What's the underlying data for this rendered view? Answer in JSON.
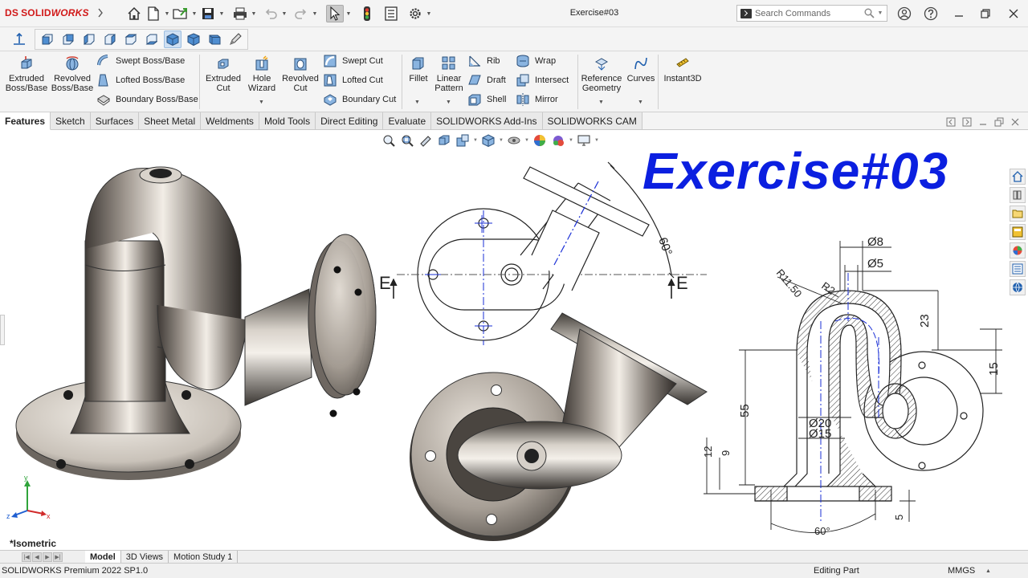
{
  "app": {
    "logo_prefix": "DS",
    "logo_solid": "SOLID",
    "logo_works": "WORKS",
    "document_title": "Exercise#03"
  },
  "search": {
    "placeholder": "Search Commands"
  },
  "ribbon": {
    "extruded_boss": "Extruded Boss/Base",
    "revolved_boss": "Revolved Boss/Base",
    "swept_boss": "Swept Boss/Base",
    "lofted_boss": "Lofted Boss/Base",
    "boundary_boss": "Boundary Boss/Base",
    "extruded_cut": "Extruded Cut",
    "hole_wizard": "Hole Wizard",
    "revolved_cut": "Revolved Cut",
    "swept_cut": "Swept Cut",
    "lofted_cut": "Lofted Cut",
    "boundary_cut": "Boundary Cut",
    "fillet": "Fillet",
    "linear_pattern": "Linear Pattern",
    "rib": "Rib",
    "draft": "Draft",
    "shell": "Shell",
    "wrap": "Wrap",
    "intersect": "Intersect",
    "mirror": "Mirror",
    "reference_geometry": "Reference Geometry",
    "curves": "Curves",
    "instant3d": "Instant3D"
  },
  "tabs": [
    {
      "label": "Features",
      "active": true
    },
    {
      "label": "Sketch"
    },
    {
      "label": "Surfaces"
    },
    {
      "label": "Sheet Metal"
    },
    {
      "label": "Weldments"
    },
    {
      "label": "Mold Tools"
    },
    {
      "label": "Direct Editing"
    },
    {
      "label": "Evaluate"
    },
    {
      "label": "SOLIDWORKS Add-Ins"
    },
    {
      "label": "SOLIDWORKS CAM"
    }
  ],
  "graphics": {
    "overlay_title": "Exercise#03",
    "view_label": "*Isometric",
    "drawing": {
      "section_label_left": "E",
      "section_label_right": "E",
      "angle_top": "60°",
      "angle_bottom": "60°",
      "dim_d8": "Ø8",
      "dim_d5": "Ø5",
      "dim_r2": "R2",
      "dim_r1150": "R11.50",
      "dim_23": "23",
      "dim_15": "15",
      "dim_55": "55",
      "dim_d20": "Ø20",
      "dim_d15": "Ø15",
      "dim_12": "12",
      "dim_9": "9",
      "dim_5": "5"
    },
    "triad": {
      "x": "x",
      "y": "y",
      "z": "z"
    }
  },
  "bottom_tabs": [
    {
      "label": "Model",
      "active": true
    },
    {
      "label": "3D Views"
    },
    {
      "label": "Motion Study 1"
    }
  ],
  "status": {
    "product": "SOLIDWORKS Premium 2022 SP1.0",
    "mode": "Editing Part",
    "units": "MMGS"
  },
  "colors": {
    "brand_red": "#d11919",
    "overlay_blue": "#0b1fe0",
    "centerline_blue": "#1a2fd6"
  }
}
